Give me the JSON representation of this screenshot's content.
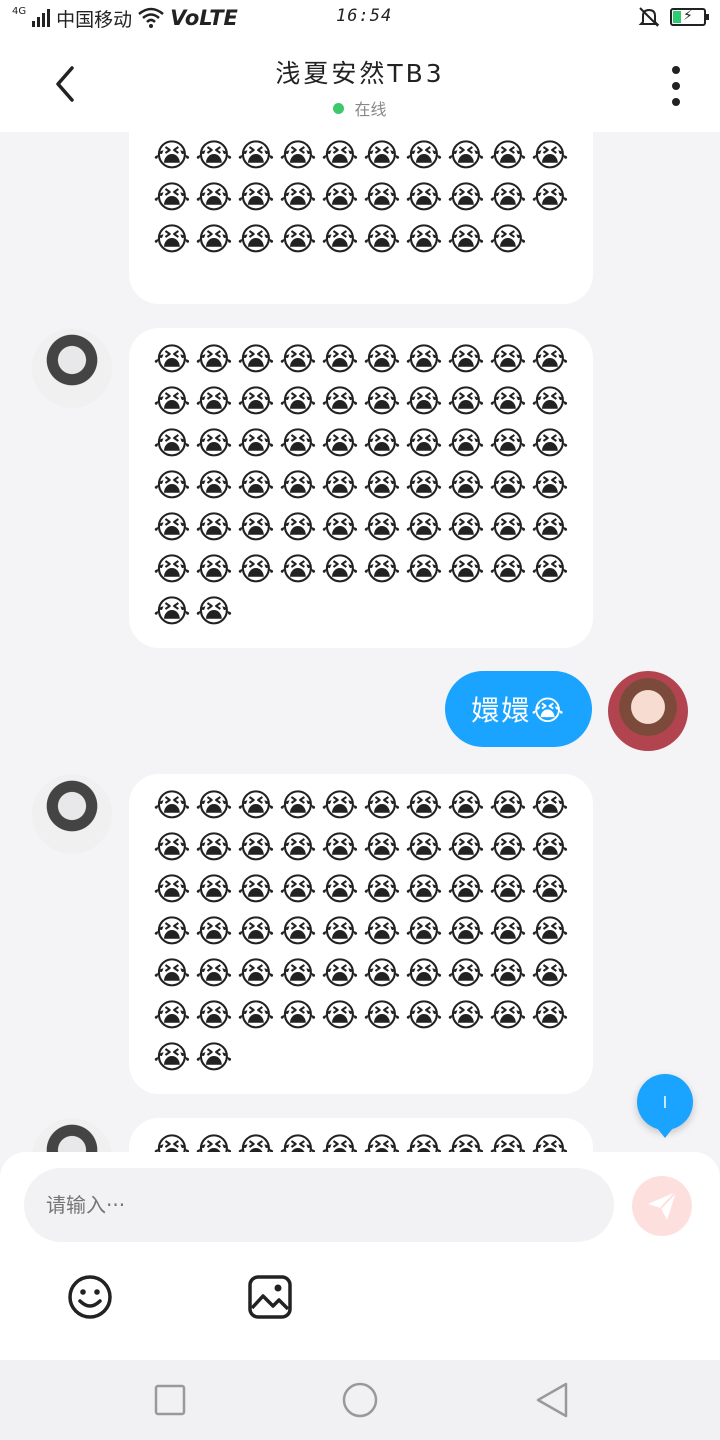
{
  "status_bar": {
    "network": "4G",
    "carrier": "中国移动",
    "volte": "VoLTE",
    "time": "16:54"
  },
  "header": {
    "title": "浅夏安然TB3",
    "status": "在线"
  },
  "messages": [
    {
      "sender": "them",
      "emoji": "😭",
      "count": 29,
      "cut_top": true
    },
    {
      "sender": "them",
      "emoji": "😭",
      "count": 62
    },
    {
      "sender": "me",
      "text": "嬛嬛😭"
    },
    {
      "sender": "them",
      "emoji": "😭",
      "count": 62
    },
    {
      "sender": "them",
      "emoji": "😭",
      "count": 10,
      "cut_bottom": true
    }
  ],
  "scroll_badge": "l",
  "composer": {
    "placeholder": "请输入···"
  },
  "icons": {
    "back": "chevron-left-icon",
    "more": "more-vertical-icon",
    "send": "send-plane-icon",
    "emoji": "smiley-icon",
    "image": "image-icon"
  },
  "colors": {
    "accent": "#1aa3ff",
    "online": "#3bc96b",
    "send_disabled": "#fde0de"
  }
}
